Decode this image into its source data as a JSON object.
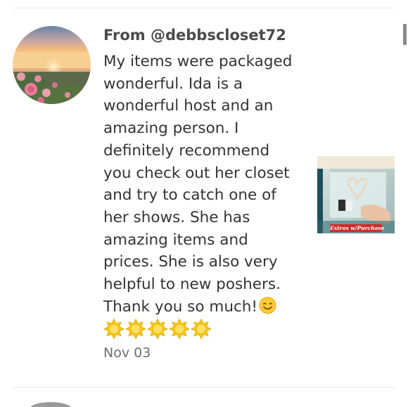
{
  "review": {
    "from_label": "From @debbscloset72",
    "message_lines": [
      "My items were packaged",
      "wonderful. Ida is a",
      "wonderful host and an",
      "amazing person. I",
      "definitely recommend",
      "you check out her closet",
      "and try to catch one of",
      "her shows. She has",
      "amazing items and",
      "prices. She is also very",
      "helpful to new poshers.",
      "Thank you so much!"
    ],
    "emoji": "smiling-face-icon",
    "stars": 5,
    "date": "Nov 03"
  },
  "thumbnail": {
    "caption": "Extras w/Purchase",
    "caption_color": "#cf2a2a"
  },
  "colors": {
    "text": "#333333",
    "username": "#4a4a4a",
    "date": "#6e6e6e",
    "star": "#f5c518",
    "divider": "#ececec"
  }
}
